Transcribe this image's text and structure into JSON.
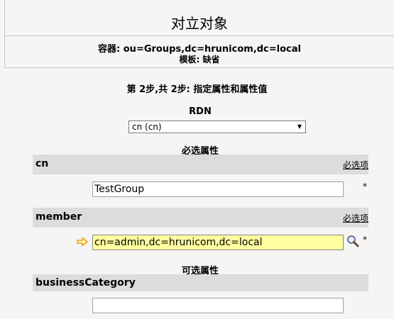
{
  "header": {
    "title": "对立对象",
    "container": "容器: ou=Groups,dc=hrunicom,dc=local",
    "template": "模板: 缺省"
  },
  "step": "第 2步,共 2步: 指定属性和属性值",
  "rdn": {
    "label": "RDN",
    "selected": "cn (cn)"
  },
  "required_section": "必选属性",
  "optional_section": "可选属性",
  "attributes": [
    {
      "name": "cn",
      "required_label": "必选项",
      "value": "TestGroup",
      "star": "*"
    },
    {
      "name": "member",
      "required_label": "必选项",
      "value": "cn=admin,dc=hrunicom,dc=local",
      "star": "*"
    },
    {
      "name": "businessCategory",
      "value": ""
    }
  ],
  "icons": {
    "arrow": "arrow-right-icon",
    "lookup": "magnifier-icon"
  },
  "colors": {
    "highlight_input": "#ffffa0",
    "attr_header_bg": "#dcdcdc",
    "arrow_icon": "#e8a317"
  }
}
